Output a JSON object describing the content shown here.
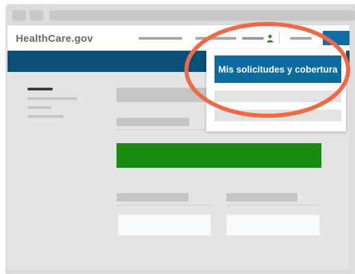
{
  "window": {
    "site_logo": "HealthCare.gov"
  },
  "account_menu": {
    "active_item_label": "Mis solicitudes y cobertura"
  },
  "colors": {
    "banner": "#0a4f75",
    "active_menu_item": "#0d6b9e",
    "primary_button": "#1a8a10",
    "highlight_ring": "#ee6a47",
    "user_icon": "#2e8b2e"
  }
}
